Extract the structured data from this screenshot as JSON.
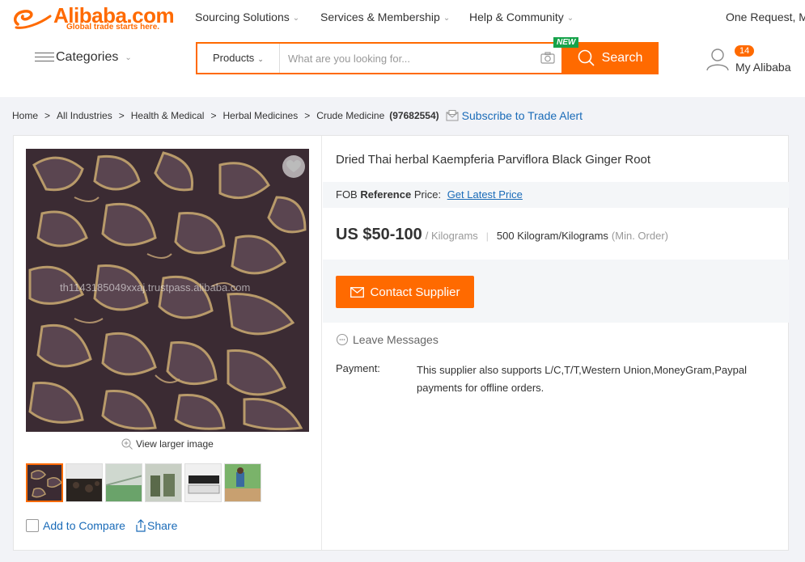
{
  "header": {
    "logo_text": "Alibaba.com",
    "logo_tagline": "Global trade starts here.",
    "nav": [
      {
        "label": "Sourcing Solutions"
      },
      {
        "label": "Services & Membership"
      },
      {
        "label": "Help & Community"
      }
    ],
    "one_request": "One Request, Mu",
    "categories_label": "Categories",
    "search": {
      "category": "Products",
      "placeholder": "What are you looking for...",
      "button_label": "Search",
      "new_badge": "NEW"
    },
    "user": {
      "message_count": "14",
      "label": "My Alibaba"
    }
  },
  "breadcrumb": {
    "items": [
      "Home",
      "All Industries",
      "Health & Medical",
      "Herbal Medicines",
      "Crude Medicine"
    ],
    "count": "(97682554)",
    "subscribe_label": "Subscribe to Trade Alert"
  },
  "product": {
    "title": "Dried Thai herbal Kaempferia Parviflora Black Ginger Root",
    "watermark": "th1143185049xxaj.trustpass.alibaba.com",
    "view_larger": "View larger image",
    "fob_prefix": "FOB ",
    "fob_bold": "Reference",
    "fob_suffix": " Price:",
    "fob_link": "Get Latest Price",
    "price": "US $50-100",
    "unit": "/ Kilograms",
    "moq": "500 Kilogram/Kilograms",
    "moq_note": "(Min. Order)",
    "contact_label": "Contact Supplier",
    "leave_messages": "Leave Messages",
    "payment_label": "Payment:",
    "payment_text": "This supplier also supports L/C,T/T,Western Union,MoneyGram,Paypal payments for offline orders.",
    "compare_label": "Add to Compare",
    "share_label": "Share"
  },
  "colors": {
    "brand": "#ff6a00",
    "link": "#1a6bb8",
    "new_badge": "#16a34a"
  },
  "icons": [
    "alibaba-logo-icon",
    "chevron-down-icon",
    "camera-icon",
    "search-icon",
    "user-icon",
    "mail-icon",
    "heart-icon",
    "zoom-icon",
    "envelope-icon",
    "chat-icon",
    "share-icon"
  ]
}
